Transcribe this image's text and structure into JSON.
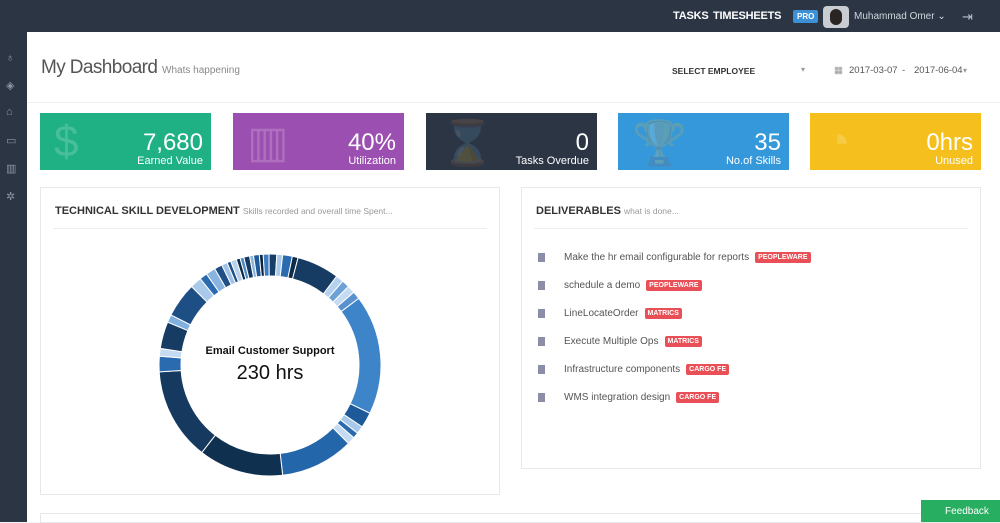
{
  "topbar": {
    "tasks": "TASKS",
    "timesheets": "TIMESHEETS",
    "pro": "PRO",
    "user": "Muhammad Omer",
    "logout_icon": "sign-out-icon"
  },
  "sidebar": {
    "icons": [
      "lightbulb-icon",
      "diamond-icon",
      "tag-icon",
      "credit-card-icon",
      "bar-chart-icon",
      "gear-icon"
    ]
  },
  "header": {
    "title": "My Dashboard",
    "subtitle": "Whats happening",
    "select_employee": "SELECT EMPLOYEE",
    "date_from": "2017-03-07",
    "date_sep": "-",
    "date_to": "2017-06-04"
  },
  "cards": [
    {
      "value": "7,680",
      "label": "Earned Value",
      "color": "#1fb084",
      "icon": "$"
    },
    {
      "value": "40%",
      "label": "Utilization",
      "color": "#9b4fb0",
      "icon": "▥"
    },
    {
      "value": "0",
      "label": "Tasks Overdue",
      "color": "#2b3544",
      "icon": "⌛"
    },
    {
      "value": "35",
      "label": "No.of Skills",
      "color": "#3498db",
      "icon": "🏆"
    },
    {
      "value": "0hrs",
      "label": "Unused",
      "color": "#f5c01d",
      "icon": "◔"
    }
  ],
  "skills": {
    "title": "TECHNICAL SKILL DEVELOPMENT",
    "subtitle": "Skills recorded and overall time Spent...",
    "center_label": "Email Customer Support",
    "center_value": "230 hrs"
  },
  "chart_data": {
    "type": "pie",
    "segments": [
      {
        "v": 3,
        "c": "#9ec3e6"
      },
      {
        "v": 2,
        "c": "#1e4f86"
      },
      {
        "v": 3,
        "c": "#b8d2ec"
      },
      {
        "v": 2,
        "c": "#0d2a4a"
      },
      {
        "v": 2,
        "c": "#4d8cc8"
      },
      {
        "v": 3,
        "c": "#15395f"
      },
      {
        "v": 2,
        "c": "#8ab4e0"
      },
      {
        "v": 3,
        "c": "#1e5a9a"
      },
      {
        "v": 2,
        "c": "#0c2540"
      },
      {
        "v": 3,
        "c": "#3c7cc0"
      },
      {
        "v": 4,
        "c": "#173e66"
      },
      {
        "v": 3,
        "c": "#a9c9ea"
      },
      {
        "v": 5,
        "c": "#2a6bb0"
      },
      {
        "v": 3,
        "c": "#0e2b4b"
      },
      {
        "v": 22,
        "c": "#163c64"
      },
      {
        "v": 4,
        "c": "#b6d1ee"
      },
      {
        "v": 4,
        "c": "#6ea2d6"
      },
      {
        "v": 4,
        "c": "#c5dbf1"
      },
      {
        "v": 4,
        "c": "#5a92cf"
      },
      {
        "v": 62,
        "c": "#3d84c9"
      },
      {
        "v": 8,
        "c": "#1e5a9a"
      },
      {
        "v": 4,
        "c": "#a9c9ea"
      },
      {
        "v": 3,
        "c": "#2a6bb0"
      },
      {
        "v": 4,
        "c": "#c5dbf1"
      },
      {
        "v": 38,
        "c": "#2466aa"
      },
      {
        "v": 44,
        "c": "#10304f"
      },
      {
        "v": 48,
        "c": "#15395f"
      },
      {
        "v": 8,
        "c": "#2a6bb0"
      },
      {
        "v": 4,
        "c": "#c5dbf1"
      },
      {
        "v": 14,
        "c": "#163c64"
      },
      {
        "v": 4,
        "c": "#7fb0e0"
      },
      {
        "v": 18,
        "c": "#1d4f85"
      },
      {
        "v": 6,
        "c": "#a9c9ea"
      },
      {
        "v": 4,
        "c": "#2a6bb0"
      },
      {
        "v": 5,
        "c": "#8ab4e0"
      },
      {
        "v": 4,
        "c": "#1e4f86"
      }
    ]
  },
  "deliverables": {
    "title": "DELIVERABLES",
    "subtitle": "what is done...",
    "items": [
      {
        "text": "Make the hr email configurable for reports",
        "tag": "PEOPLEWARE"
      },
      {
        "text": "schedule a demo",
        "tag": "PEOPLEWARE"
      },
      {
        "text": "LineLocateOrder",
        "tag": "MATRICS"
      },
      {
        "text": "Execute Multiple Ops",
        "tag": "MATRICS"
      },
      {
        "text": "Infrastructure components",
        "tag": "CARGO FE"
      },
      {
        "text": "WMS integration design",
        "tag": "CARGO FE"
      }
    ]
  },
  "feedback": "Feedback"
}
